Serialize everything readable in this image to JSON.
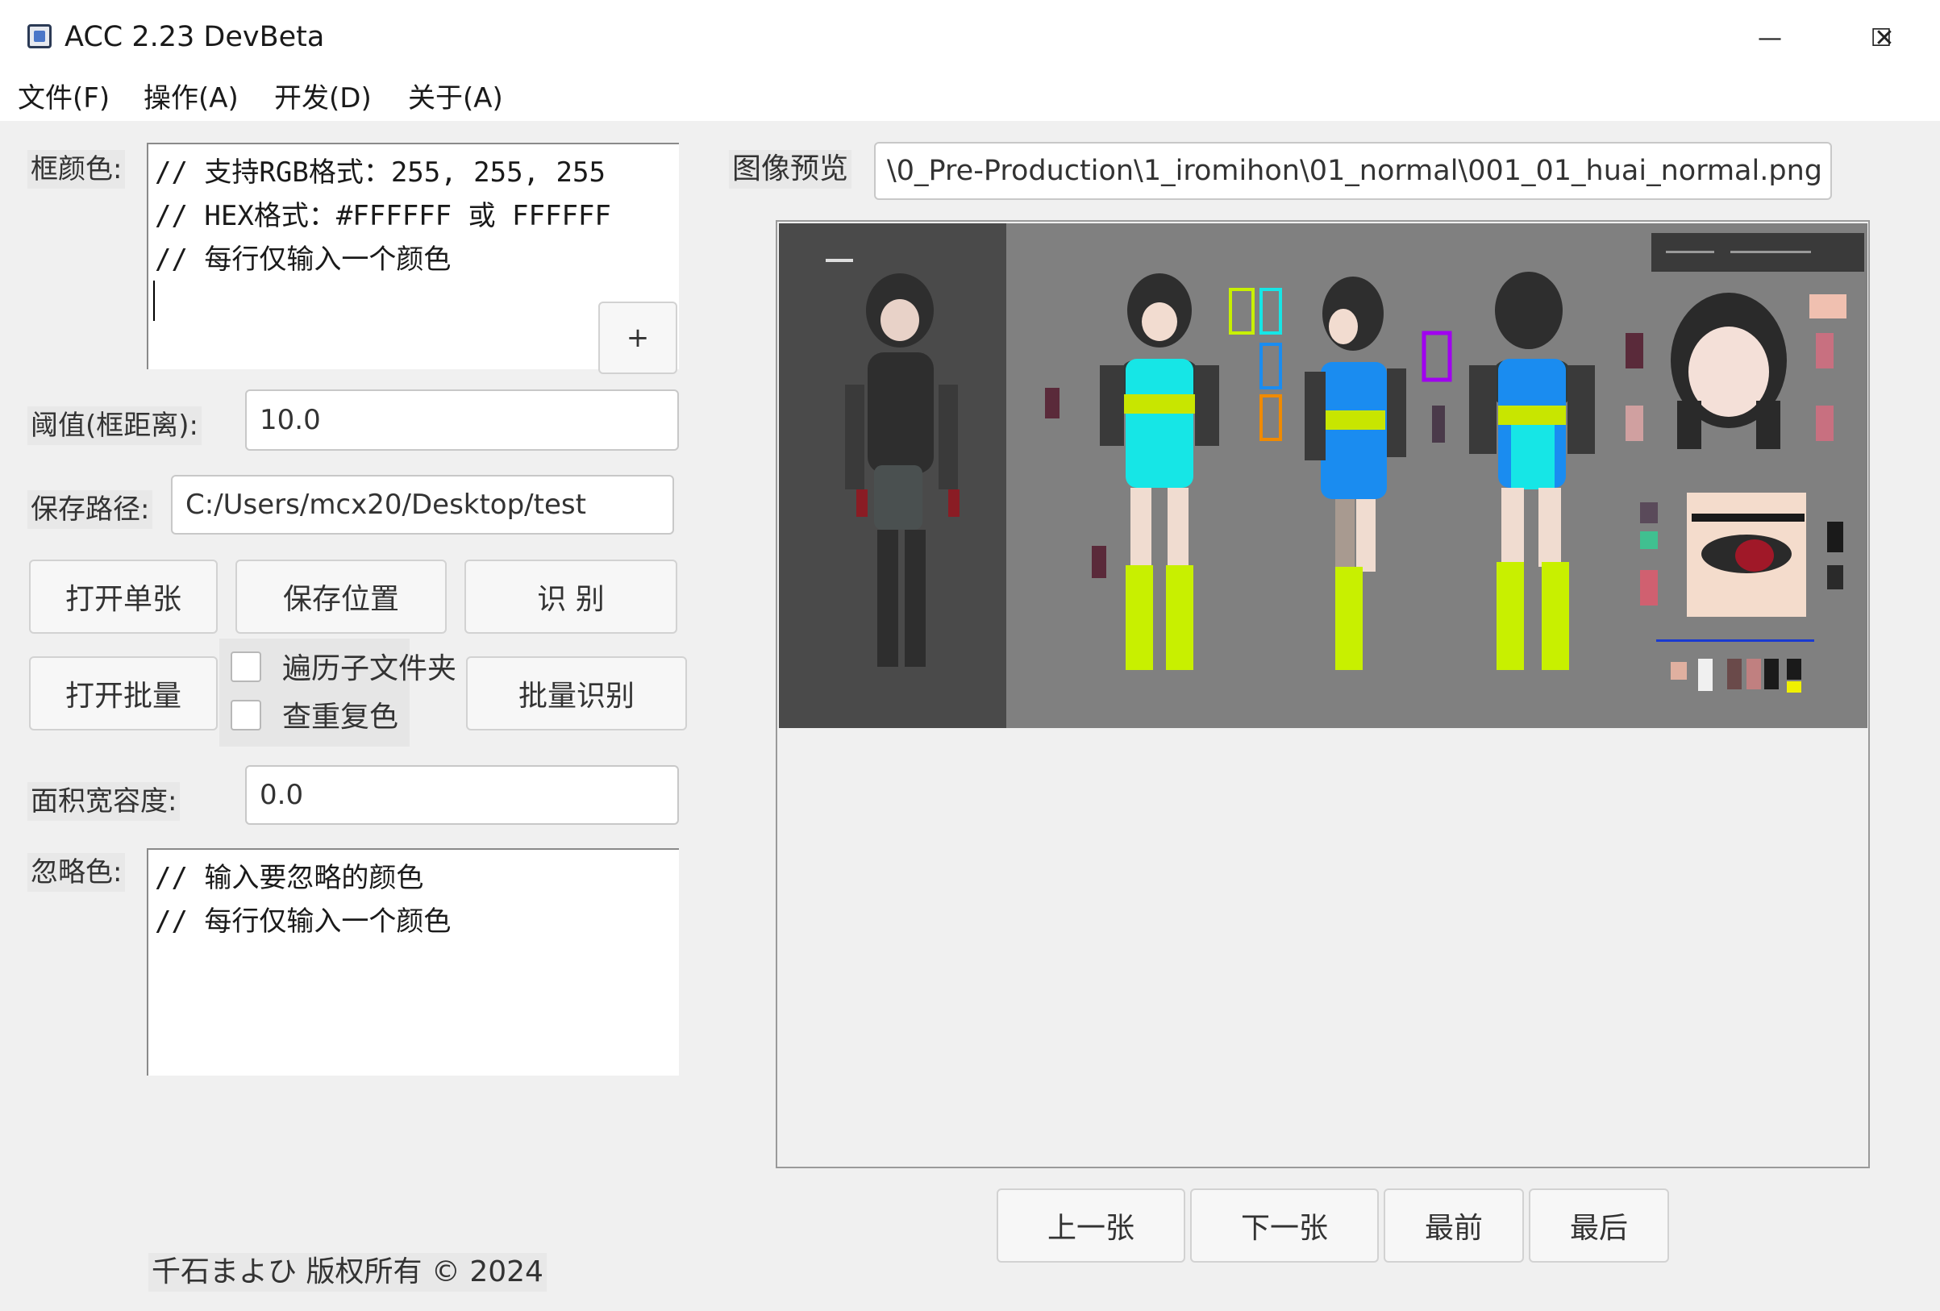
{
  "window": {
    "title": "ACC 2.23 DevBeta",
    "controls": {
      "minimize": "—",
      "maximize": "☐",
      "close": "✕"
    }
  },
  "menu": [
    "文件(F)",
    "操作(A)",
    "开发(D)",
    "关于(A)"
  ],
  "form": {
    "box_color_label": "框颜色:",
    "box_color_text": "// 支持RGB格式：255, 255, 255\n// HEX格式：#FFFFFF 或 FFFFFF\n// 每行仅输入一个颜色\n",
    "add_button": "+",
    "threshold_label": "阈值(框距离):",
    "threshold_value": "10.0",
    "save_path_label": "保存路径:",
    "save_path_value": "C:/Users/mcx20/Desktop/test",
    "buttons": {
      "open_single": "打开单张",
      "save_location": "保存位置",
      "recognize": "识 别",
      "open_batch": "打开批量",
      "batch_recognize": "批量识别"
    },
    "checkboxes": {
      "traverse_subfolders": "遍历子文件夹",
      "check_duplicate_colors": "查重复色"
    },
    "area_tolerance_label": "面积宽容度:",
    "area_tolerance_value": "0.0",
    "ignore_color_label": "忽略色:",
    "ignore_color_text": "// 输入要忽略的颜色\n// 每行仅输入一个颜色"
  },
  "preview": {
    "label": "图像预览",
    "path": "\\0_Pre-Production\\1_iromihon\\01_normal\\001_01_huai_normal.png"
  },
  "navigation": {
    "prev": "上一张",
    "next": "下一张",
    "first": "最前",
    "last": "最后"
  },
  "footer": "千石まよひ 版权所有 © 2024",
  "colors": {
    "window_bg": "#f0f0f0",
    "titlebar_bg": "#ffffff",
    "preview_bg": "#808080",
    "preview_left_panel": "#4a4a4a"
  }
}
